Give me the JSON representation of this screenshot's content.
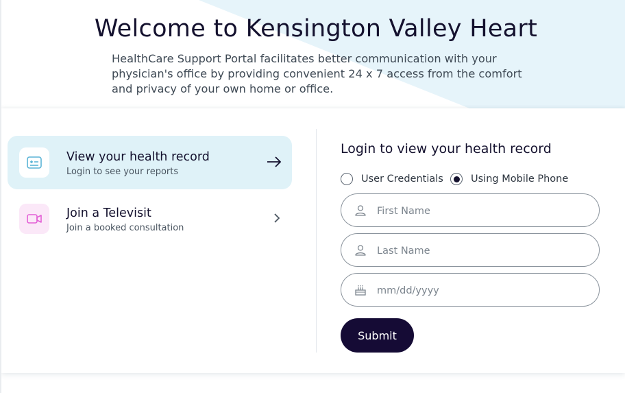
{
  "hero": {
    "title": "Welcome to Kensington Valley Heart",
    "description": "HealthCare Support Portal facilitates better communication with your physician's office by providing convenient 24 x 7 access from the comfort and privacy of your own home or office."
  },
  "options": [
    {
      "title": "View your health record",
      "subtitle": "Login to see your reports",
      "icon": "health-record-icon",
      "arrow": "arrow-right-icon",
      "active": true
    },
    {
      "title": "Join a Televisit",
      "subtitle": "Join a booked consultation",
      "icon": "video-camera-icon",
      "arrow": "chevron-right-icon",
      "active": false
    }
  ],
  "login": {
    "title": "Login to view your health record",
    "radios": [
      {
        "label": "User Credentials",
        "selected": false
      },
      {
        "label": "Using Mobile Phone",
        "selected": true
      }
    ],
    "fields": [
      {
        "placeholder": "First Name",
        "value": "",
        "icon": "user-icon"
      },
      {
        "placeholder": "Last Name",
        "value": "",
        "icon": "user-icon"
      },
      {
        "placeholder": "mm/dd/yyyy",
        "value": "",
        "icon": "birthday-cake-icon"
      }
    ],
    "submit_label": "Submit"
  },
  "colors": {
    "accent": "#150b35",
    "active_option_bg": "#dff2f8",
    "hero_bg": "#e6f4fa",
    "icon_blue": "#5ab4d6",
    "icon_pink": "#e35fd6"
  }
}
